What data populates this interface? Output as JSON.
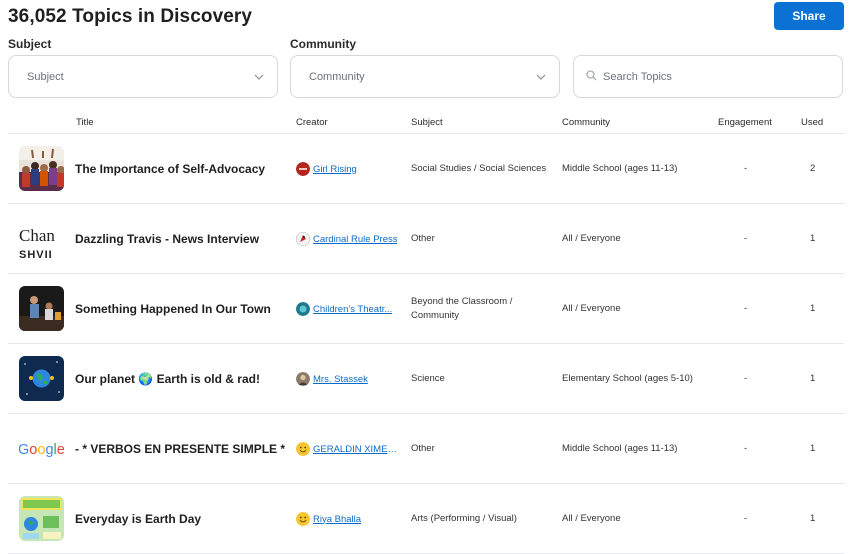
{
  "page": {
    "title": "36,052 Topics in Discovery",
    "share_label": "Share"
  },
  "filters": {
    "subject_label": "Subject",
    "subject_placeholder": "Subject",
    "community_label": "Community",
    "community_placeholder": "Community",
    "search_placeholder": "Search Topics"
  },
  "table": {
    "columns": [
      "Title",
      "Creator",
      "Subject",
      "Community",
      "Engagement",
      "Used"
    ],
    "rows": [
      {
        "title": "The Importance of Self-Advocacy",
        "creator": "Girl Rising",
        "subject": "Social Studies / Social Sciences",
        "community": "Middle School (ages 11-13)",
        "engagement": "-",
        "used": "2",
        "thumb_icon": "crowd-photo-thumbnail",
        "avatar_icon": "girl-rising-avatar"
      },
      {
        "title": "Dazzling Travis - News Interview",
        "creator": "Cardinal Rule Press",
        "subject": "Other",
        "community": "All / Everyone",
        "engagement": "-",
        "used": "1",
        "thumb_icon": "news-text-thumbnail",
        "avatar_icon": "cardinal-avatar"
      },
      {
        "title": "Something Happened In Our Town",
        "creator": "Children's Theatr...",
        "subject": "Beyond the Classroom / Community",
        "community": "All / Everyone",
        "engagement": "-",
        "used": "1",
        "thumb_icon": "stage-photo-thumbnail",
        "avatar_icon": "theatre-avatar"
      },
      {
        "title": "Our planet 🌍 Earth is old & rad!",
        "creator": "Mrs. Stassek",
        "subject": "Science",
        "community": "Elementary School (ages 5-10)",
        "engagement": "-",
        "used": "1",
        "thumb_icon": "earth-thumbnail",
        "avatar_icon": "user-photo-avatar"
      },
      {
        "title": "- * VERBOS EN PRESENTE SIMPLE *",
        "creator": "GERALDIN XIMEN...",
        "subject": "Other",
        "community": "Middle School (ages 11-13)",
        "engagement": "-",
        "used": "1",
        "thumb_icon": "google-logo-thumbnail",
        "avatar_icon": "smiley-avatar"
      },
      {
        "title": "Everyday is Earth Day",
        "creator": "Riya Bhalla",
        "subject": "Arts (Performing / Visual)",
        "community": "All / Everyone",
        "engagement": "-",
        "used": "1",
        "thumb_icon": "earth-day-poster-thumbnail",
        "avatar_icon": "smiley-avatar"
      }
    ]
  },
  "colors": {
    "accent": "#0b72d4",
    "link": "#0b6bc8",
    "border": "#d4d7db"
  }
}
